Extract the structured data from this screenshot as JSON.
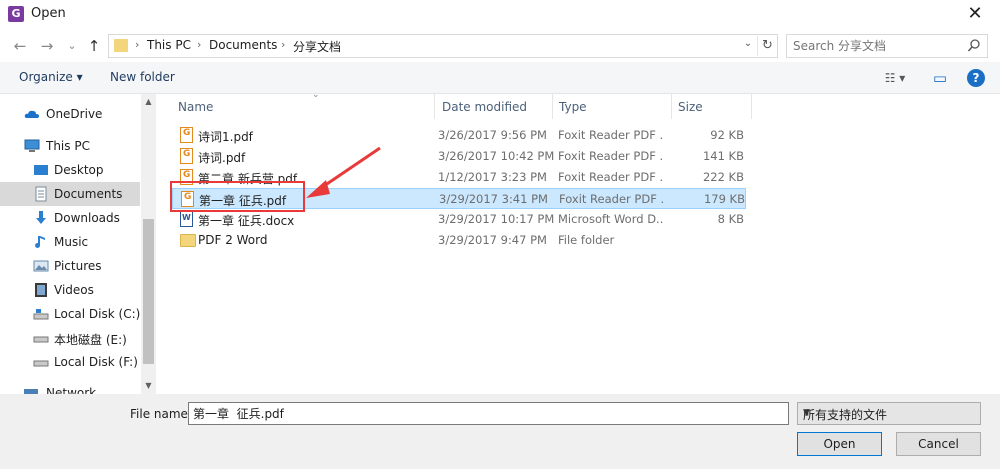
{
  "window": {
    "title": "Open",
    "app_icon": "foxit-icon",
    "close_glyph": "✕"
  },
  "nav_buttons": {
    "back": "←",
    "forward": "→",
    "recent": "⌄",
    "up": "↑"
  },
  "address": {
    "crumbs": [
      "This PC",
      "Documents",
      "分享文档"
    ],
    "separator": "›",
    "dropdown": "⌄",
    "refresh": "↻"
  },
  "search": {
    "placeholder": "Search 分享文档"
  },
  "toolbar": {
    "organize_label": "Organize ▾",
    "new_folder_label": "New folder",
    "view_glyph": "☷ ▾",
    "preview_glyph": "▭",
    "help_glyph": "?"
  },
  "nav_items": [
    {
      "label": "OneDrive",
      "icon": "cloud-icon"
    },
    {
      "label": "This PC",
      "icon": "computer-icon"
    },
    {
      "label": "Desktop",
      "icon": "desktop-icon"
    },
    {
      "label": "Documents",
      "icon": "documents-icon",
      "selected": true
    },
    {
      "label": "Downloads",
      "icon": "download-icon"
    },
    {
      "label": "Music",
      "icon": "music-icon"
    },
    {
      "label": "Pictures",
      "icon": "pictures-icon"
    },
    {
      "label": "Videos",
      "icon": "videos-icon"
    },
    {
      "label": "Local Disk (C:)",
      "icon": "drive-c-icon"
    },
    {
      "label": "本地磁盘 (E:)",
      "icon": "drive-e-icon"
    },
    {
      "label": "Local Disk (F:)",
      "icon": "drive-f-icon"
    }
  ],
  "nav_partial": "Network",
  "columns": {
    "name": "Name",
    "date": "Date modified",
    "type": "Type",
    "size": "Size"
  },
  "files": [
    {
      "name": "诗词1.pdf",
      "date": "3/26/2017 9:56 PM",
      "type": "Foxit Reader PDF ...",
      "size": "92 KB",
      "kind": "pdf"
    },
    {
      "name": "诗词.pdf",
      "date": "3/26/2017 10:42 PM",
      "type": "Foxit Reader PDF ...",
      "size": "141 KB",
      "kind": "pdf"
    },
    {
      "name": "第二章 新兵营.pdf",
      "date": "1/12/2017 3:23 PM",
      "type": "Foxit Reader PDF ...",
      "size": "222 KB",
      "kind": "pdf"
    },
    {
      "name": "第一章  征兵.pdf",
      "date": "3/29/2017 3:41 PM",
      "type": "Foxit Reader PDF ...",
      "size": "179 KB",
      "kind": "pdf",
      "selected": true
    },
    {
      "name": "第一章  征兵.docx",
      "date": "3/29/2017 10:17 PM",
      "type": "Microsoft Word D...",
      "size": "8 KB",
      "kind": "doc"
    },
    {
      "name": "PDF 2 Word",
      "date": "3/29/2017 9:47 PM",
      "type": "File folder",
      "size": "",
      "kind": "dir"
    }
  ],
  "bottom": {
    "file_name_label": "File name:",
    "file_name_value": "第一章  征兵.pdf",
    "file_type_value": "所有支持的文件",
    "open_label": "Open",
    "cancel_label": "Cancel"
  },
  "colors": {
    "selection": "#cce8ff",
    "highlight_annotation": "#e83a3a",
    "accent": "#0078d7"
  }
}
